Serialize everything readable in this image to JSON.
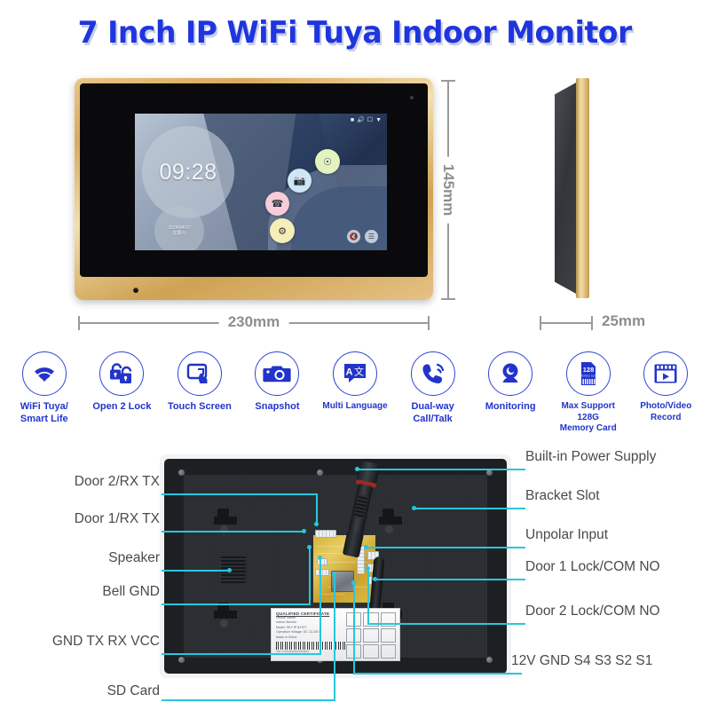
{
  "header": {
    "title": "7 Inch IP WiFi Tuya Indoor Monitor",
    "title_color": "#1f35dd"
  },
  "product_views": {
    "front": {
      "screen": {
        "clock": "09:28",
        "date": "2024/04/27",
        "weekday": "星期六",
        "status_icons": [
          "battery-icon",
          "volume-icon",
          "monitor-icon",
          "wifi-icon"
        ],
        "app_icons": [
          {
            "name": "intercom-app-icon",
            "color": "#e3f3bf"
          },
          {
            "name": "camera-app-icon",
            "color": "#cfe6f7"
          },
          {
            "name": "call-app-icon",
            "color": "#f6cdd8"
          },
          {
            "name": "settings-app-icon",
            "color": "#f6eeb7"
          }
        ],
        "tray_icons": [
          "mute-icon",
          "menu-icon"
        ]
      },
      "bezel_color": "#d8ab5c"
    },
    "side": {
      "body_color": "#32363a",
      "edge_color": "#e7c888"
    }
  },
  "dimensions": {
    "width_label": "230mm",
    "height_label": "145mm",
    "depth_label": "25mm",
    "line_color": "#9a9a9a"
  },
  "features": {
    "accent_color": "#2234c9",
    "items": [
      {
        "icon": "wifi-icon",
        "label_line1": "WiFi Tuya/",
        "label_line2": "Smart Life"
      },
      {
        "icon": "two-locks-icon",
        "label_line1": "Open 2 Lock",
        "label_line2": ""
      },
      {
        "icon": "touch-screen-icon",
        "label_line1": "Touch Screen",
        "label_line2": ""
      },
      {
        "icon": "camera-icon",
        "label_line1": "Snapshot",
        "label_line2": ""
      },
      {
        "icon": "translate-icon",
        "label_line1": "Multi Language",
        "label_line2": ""
      },
      {
        "icon": "phone-call-icon",
        "label_line1": "Dual-way",
        "label_line2": "Call/Talk"
      },
      {
        "icon": "webcam-icon",
        "label_line1": "Monitoring",
        "label_line2": ""
      },
      {
        "icon": "sd-card-icon",
        "label_line1": "Max Support 128G",
        "label_line2": "Memory Card",
        "badge": "128"
      },
      {
        "icon": "video-record-icon",
        "label_line1": "Photo/Video",
        "label_line2": "Record"
      }
    ]
  },
  "rear_panel": {
    "leader_color": "#29c6dd",
    "callouts_left": [
      {
        "label": "Door 2/RX TX"
      },
      {
        "label": "Door 1/RX TX"
      },
      {
        "label": "Speaker"
      },
      {
        "label": "Bell GND"
      },
      {
        "label": "GND TX RX VCC"
      },
      {
        "label": "SD Card"
      }
    ],
    "callouts_right": [
      {
        "label": "Built-in Power Supply"
      },
      {
        "label": "Bracket Slot"
      },
      {
        "label": "Unpolar Input"
      },
      {
        "label": "Door 1 Lock/COM NO"
      },
      {
        "label": "Door 2 Lock/COM NO"
      },
      {
        "label": "12V GND S4 S3 S2 S1"
      }
    ],
    "certificate_label": {
      "title": "QUALIFIED CERTIFICATE",
      "line1": "Device Name:",
      "line2": "Indoor Monitor",
      "line3": "Model: SKY IP 8470T",
      "line4": "Operation Voltage: DC 12-24V",
      "line5": "Made in China",
      "sn": "S/N: 6770LB0236A2530001"
    }
  }
}
